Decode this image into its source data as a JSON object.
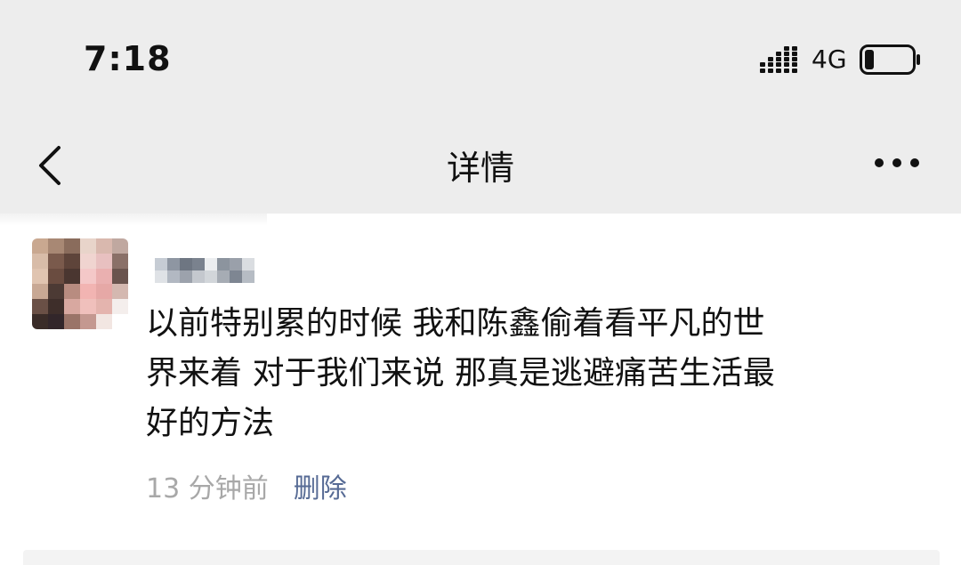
{
  "status_bar": {
    "time": "7:18",
    "network": "4G",
    "signal_icon": "cellular-signal-icon",
    "battery_icon": "battery-low-icon",
    "battery_level": 0.2
  },
  "nav": {
    "title": "详情",
    "back_icon": "chevron-left-icon",
    "more_icon": "more-horizontal-icon"
  },
  "post": {
    "text": "以前特别累的时候 我和陈鑫偷着看平凡的世\n界来着 对于我们来说 那真是逃避痛苦生活最\n好的方法",
    "timestamp": "13 分钟前",
    "delete_label": "删除"
  },
  "colors": {
    "bar_background": "#ededed",
    "link": "#576b95",
    "muted_text": "#a8a8a8",
    "text": "#111111"
  }
}
